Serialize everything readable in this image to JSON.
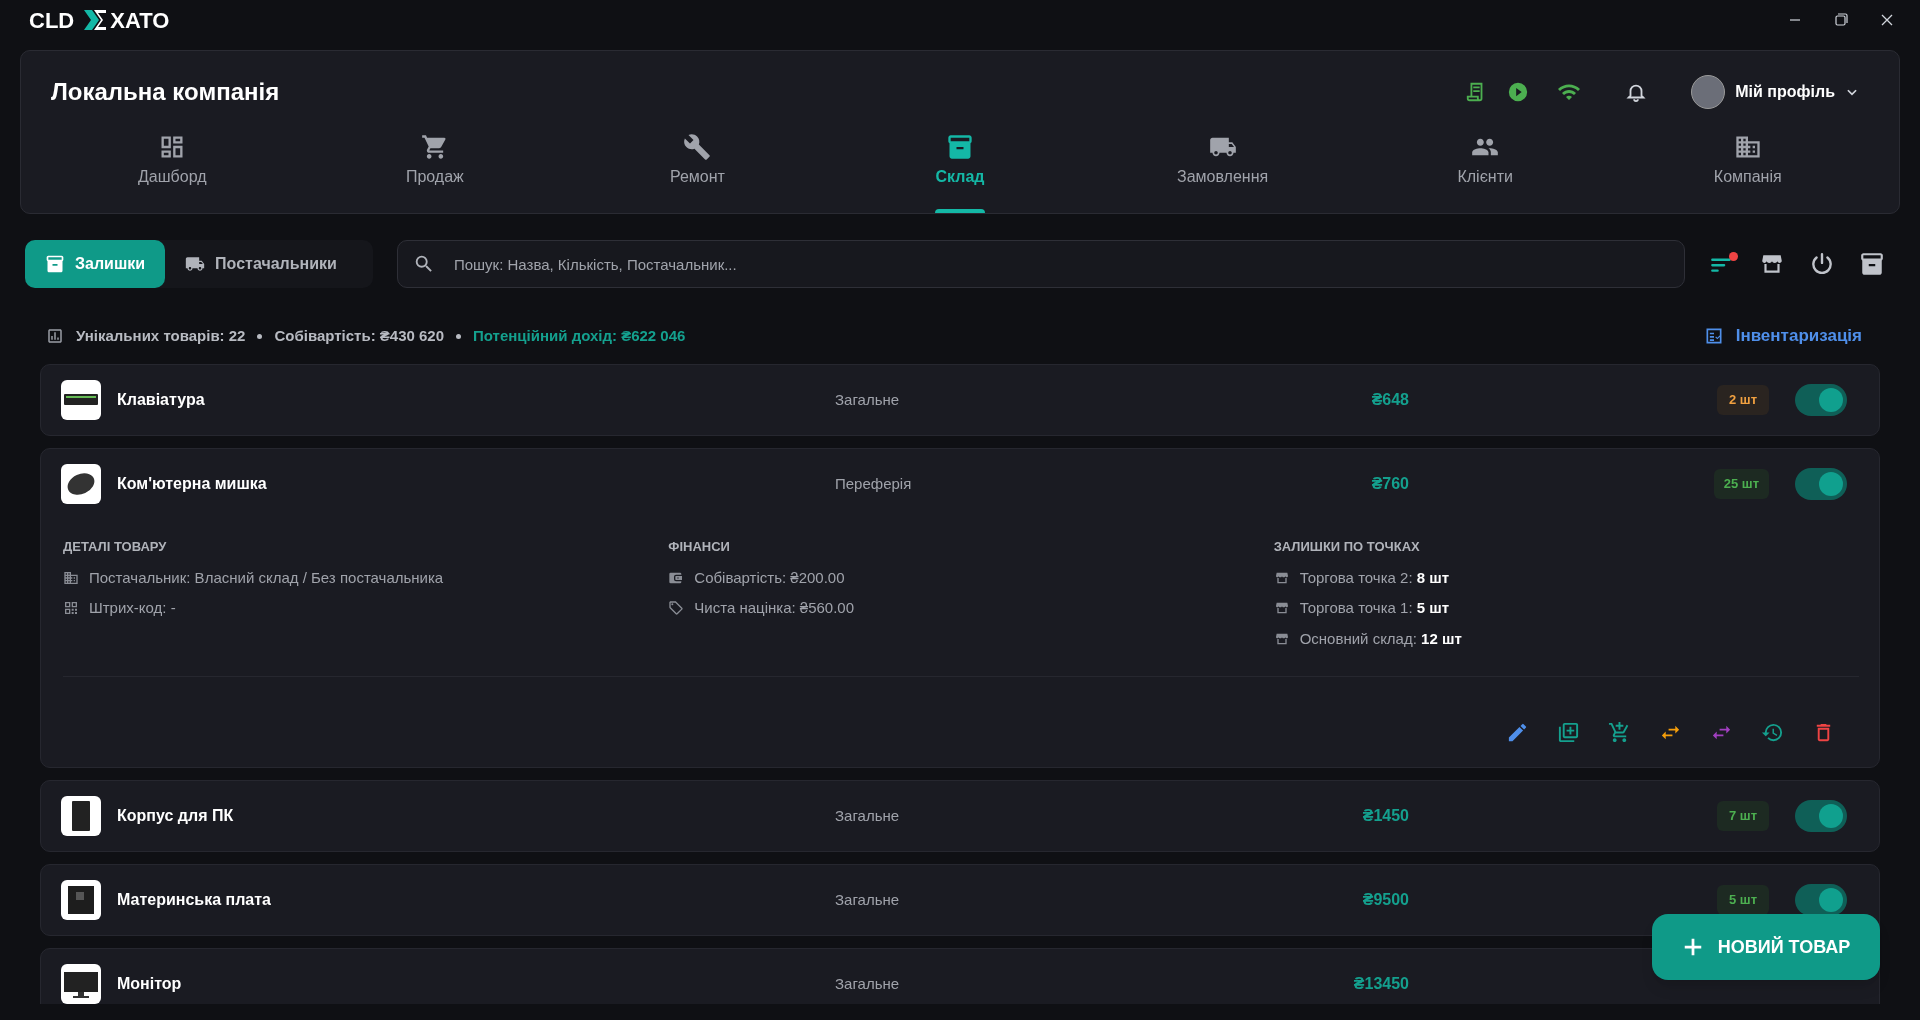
{
  "app": {
    "logo_left": "CLD",
    "logo_right": "XATO"
  },
  "header": {
    "company": "Локальна компанія",
    "profile": {
      "label": "Мій профіль"
    }
  },
  "nav": [
    {
      "label": "Дашборд",
      "selected": false
    },
    {
      "label": "Продаж",
      "selected": false
    },
    {
      "label": "Ремонт",
      "selected": false
    },
    {
      "label": "Склад",
      "selected": true
    },
    {
      "label": "Замовлення",
      "selected": false
    },
    {
      "label": "Клієнти",
      "selected": false
    },
    {
      "label": "Компанія",
      "selected": false
    }
  ],
  "subtabs": [
    {
      "label": "Залишки",
      "selected": true
    },
    {
      "label": "Постачальники",
      "selected": false
    }
  ],
  "search": {
    "placeholder": "Пошук: Назва, Кількість, Постачальник..."
  },
  "filter": {
    "active": true
  },
  "stats": {
    "unique": "Унікальних товарів: 22",
    "cost": "Собівартість: ₴430 620",
    "revenue": "Потенційний дохід: ₴622 046"
  },
  "inventory_link": "Інвентаризація",
  "products": [
    {
      "name": "Клавіатура",
      "category": "Загальне",
      "price": "₴648",
      "qty": "2 шт",
      "low_stock": true,
      "enabled": true,
      "expanded": false
    },
    {
      "name": "Ком'ютерна мишка",
      "category": "Переферія",
      "price": "₴760",
      "qty": "25 шт",
      "low_stock": false,
      "enabled": true,
      "expanded": true,
      "details": [
        {
          "title": "ДЕТАЛІ ТОВАРУ",
          "lines": [
            "Постачальник: Власний склад / Без постачальника",
            "Штрих-код: -"
          ]
        },
        {
          "title": "ФІНАНСИ",
          "lines": [
            "Собівартість: ₴200.00",
            "Чиста націнка: ₴560.00"
          ]
        },
        {
          "title": "ЗАЛИШКИ ПО ТОЧКАХ",
          "lines": [
            "Торгова точка 2: **8 шт**",
            "Торгова точка 1: **5 шт**",
            "Основний склад: **12 шт**"
          ]
        }
      ]
    },
    {
      "name": "Корпус для ПК",
      "category": "Загальне",
      "price": "₴1450",
      "qty": "7 шт",
      "low_stock": false,
      "enabled": true,
      "expanded": false
    },
    {
      "name": "Материнська плата",
      "category": "Загальне",
      "price": "₴9500",
      "qty": "5 шт",
      "low_stock": false,
      "enabled": true,
      "expanded": false
    },
    {
      "name": "Монітор",
      "category": "Загальне",
      "price": "₴13450",
      "expanded": false
    }
  ],
  "new_button": "НОВИЙ ТОВАР"
}
